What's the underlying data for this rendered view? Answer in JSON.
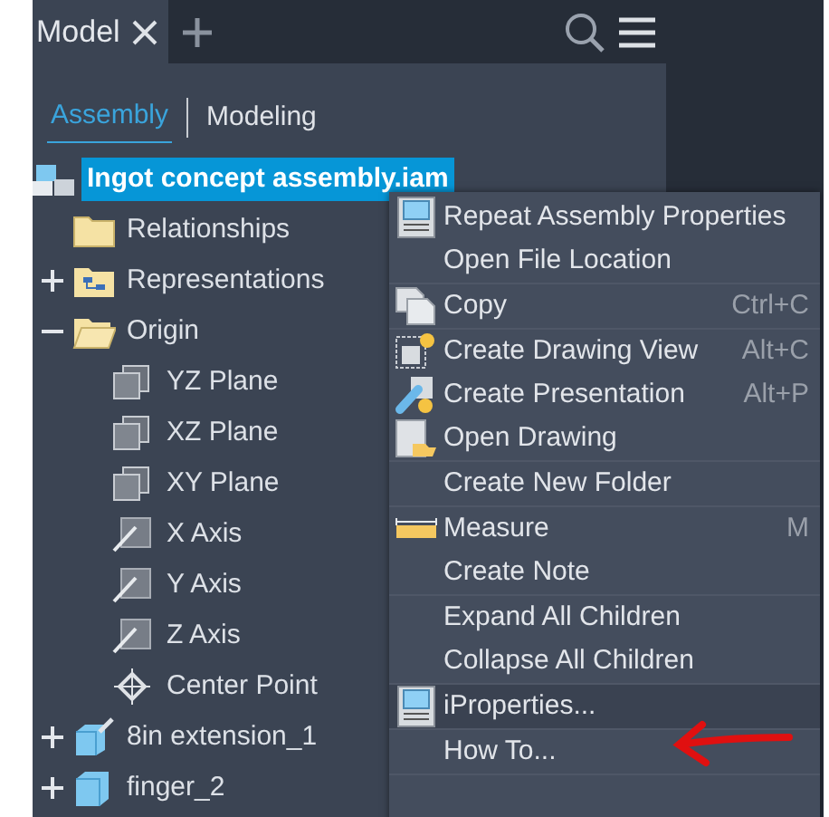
{
  "tabs": [
    {
      "label": "Model",
      "selected": true,
      "closable": true
    }
  ],
  "browser_tabs": [
    {
      "label": "Assembly",
      "selected": true
    },
    {
      "label": "Modeling",
      "selected": false
    }
  ],
  "tree": {
    "label": "Ingot concept assembly.iam",
    "kind": "assembly",
    "selected": true,
    "children": [
      {
        "label": "Relationships",
        "kind": "folder"
      },
      {
        "label": "Representations",
        "kind": "representations",
        "expanded": false
      },
      {
        "label": "Origin",
        "kind": "open-folder",
        "expanded": true,
        "children": [
          {
            "label": "YZ Plane",
            "kind": "plane"
          },
          {
            "label": "XZ Plane",
            "kind": "plane"
          },
          {
            "label": "XY Plane",
            "kind": "plane"
          },
          {
            "label": "X Axis",
            "kind": "axis"
          },
          {
            "label": "Y Axis",
            "kind": "axis"
          },
          {
            "label": "Z Axis",
            "kind": "axis"
          },
          {
            "label": "Center Point",
            "kind": "point"
          }
        ]
      },
      {
        "label": "8in extension_1",
        "kind": "pinned-part",
        "expanded": false
      },
      {
        "label": "finger_2",
        "kind": "part",
        "expanded": false
      }
    ]
  },
  "context_menu": {
    "groups": [
      [
        {
          "label": "Repeat Assembly Properties",
          "kind": "properties",
          "selected": false
        },
        {
          "label": "Open File Location",
          "selected": false
        }
      ],
      [
        {
          "label": "Copy",
          "kind": "copy",
          "shortcut": "Ctrl+C",
          "selected": false
        }
      ],
      [
        {
          "label": "Create Drawing View",
          "kind": "drawing-view",
          "shortcut": "Alt+C",
          "selected": false
        },
        {
          "label": "Create Presentation",
          "kind": "presentation",
          "shortcut": "Alt+P",
          "selected": false
        },
        {
          "label": "Open Drawing",
          "kind": "open-drawing",
          "selected": false
        }
      ],
      [
        {
          "label": "Create New Folder",
          "selected": false
        }
      ],
      [
        {
          "label": "Measure",
          "kind": "ruler",
          "shortcut": "M",
          "selected": false
        },
        {
          "label": "Create Note",
          "selected": false
        }
      ],
      [
        {
          "label": "Expand All Children",
          "selected": false
        },
        {
          "label": "Collapse All Children",
          "selected": false
        }
      ],
      [
        {
          "label": "iProperties...",
          "kind": "properties",
          "selected": true
        }
      ],
      [
        {
          "label": "How To...",
          "selected": false
        }
      ]
    ]
  }
}
